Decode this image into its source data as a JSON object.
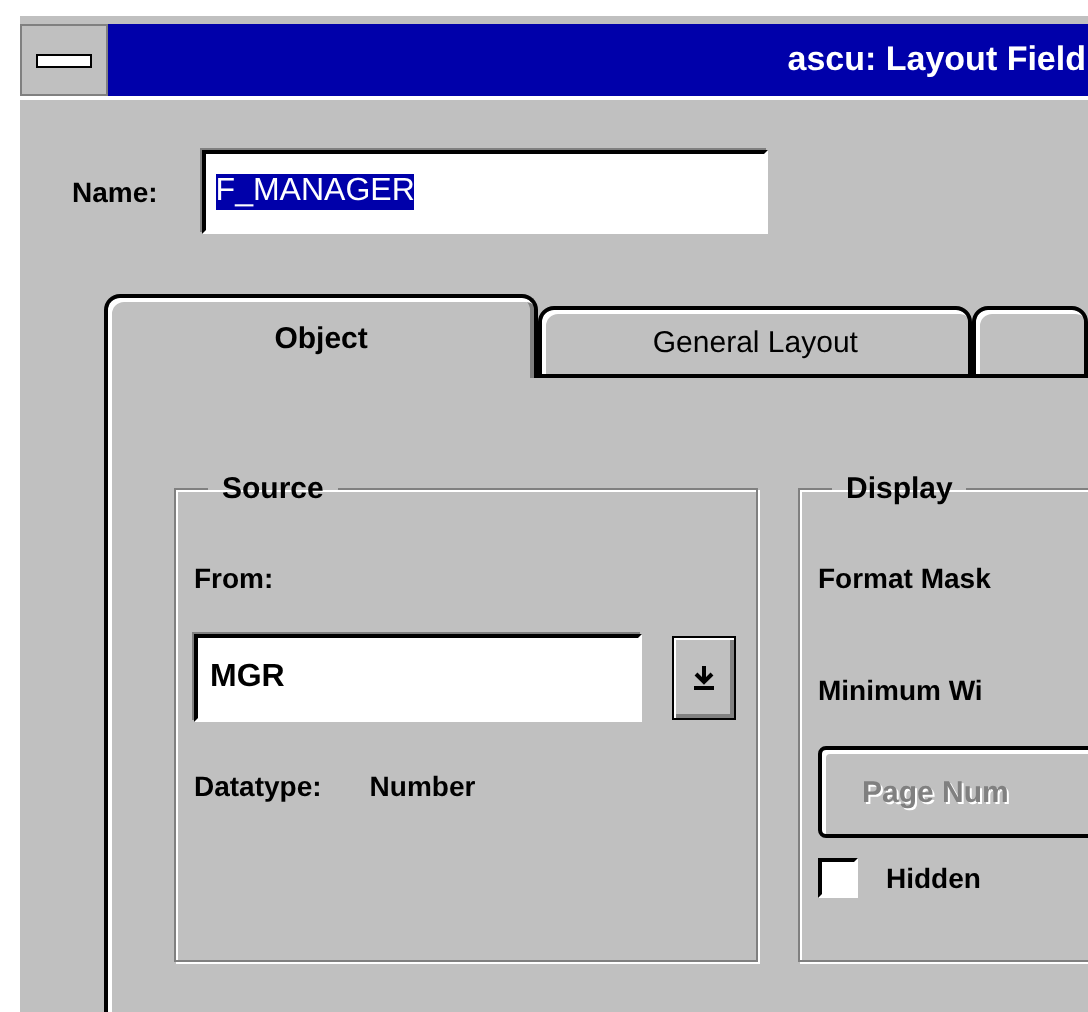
{
  "window": {
    "title": "ascu: Layout Field"
  },
  "name_field": {
    "label": "Name:",
    "value": "F_MANAGER",
    "text_selected": true
  },
  "tabs": [
    {
      "label": "Object",
      "selected": true
    },
    {
      "label": "General Layout",
      "selected": false
    },
    {
      "selected": false
    }
  ],
  "source": {
    "title": "Source",
    "from_label": "From:",
    "from_value": "MGR",
    "datatype_label": "Datatype:",
    "datatype_value": "Number"
  },
  "display": {
    "title": "Display",
    "format_mask_label": "Format Mask",
    "minimum_width_label": "Minimum Wi",
    "page_numbering_button": {
      "label": "Page Num",
      "disabled": true
    },
    "hidden": {
      "label": "Hidden",
      "checked": false
    }
  }
}
